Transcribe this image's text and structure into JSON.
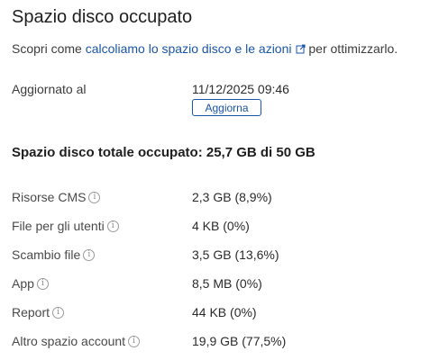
{
  "page": {
    "title": "Spazio disco occupato",
    "intro": {
      "before": "Scopri come ",
      "link": "calcoliamo lo spazio disco e le azioni",
      "after": " per ottimizzarlo."
    }
  },
  "updated": {
    "label": "Aggiornato al",
    "value": "11/12/2025 09:46",
    "refresh_label": "Aggiorna"
  },
  "total": {
    "text": "Spazio disco totale occupato: 25,7 GB di 50 GB"
  },
  "usage_rows": [
    {
      "label": "Risorse CMS",
      "value": "2,3 GB (8,9%)"
    },
    {
      "label": "File per gli utenti",
      "value": "4 KB (0%)"
    },
    {
      "label": "Scambio file",
      "value": "3,5 GB (13,6%)"
    },
    {
      "label": "App",
      "value": "8,5 MB (0%)"
    },
    {
      "label": "Report",
      "value": "44 KB (0%)"
    },
    {
      "label": "Altro spazio account",
      "value": "19,9 GB (77,5%)"
    }
  ],
  "icons": {
    "external_link": "external-link-icon",
    "info": "info-icon"
  },
  "colors": {
    "link": "#1a56a8",
    "text": "#2b2b2b"
  }
}
